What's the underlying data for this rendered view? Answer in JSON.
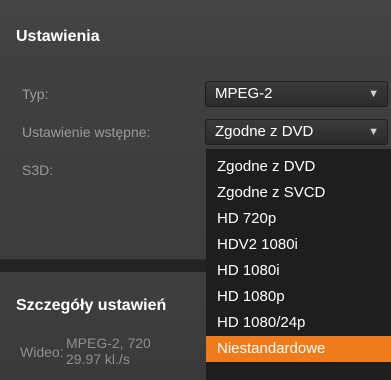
{
  "settings": {
    "title": "Ustawienia",
    "type_label": "Typ:",
    "type_value": "MPEG-2",
    "preset_label": "Ustawienie wstępne:",
    "preset_value": "Zgodne z DVD",
    "s3d_label": "S3D:"
  },
  "dropdown": {
    "options": [
      "Zgodne z DVD",
      "Zgodne z SVCD",
      "HD 720p",
      "HDV2 1080i",
      "HD 1080i",
      "HD 1080p",
      "HD 1080/24p",
      "Niestandardowe"
    ],
    "highlighted": "Niestandardowe",
    "highlight_color": "#f07b1a"
  },
  "details": {
    "title": "Szczegóły ustawień",
    "video_label": "Wideo:",
    "video_line1": "MPEG-2, 720",
    "video_line2": "29.97 kl./s"
  },
  "icons": {
    "dropdown_arrow": "▼"
  }
}
